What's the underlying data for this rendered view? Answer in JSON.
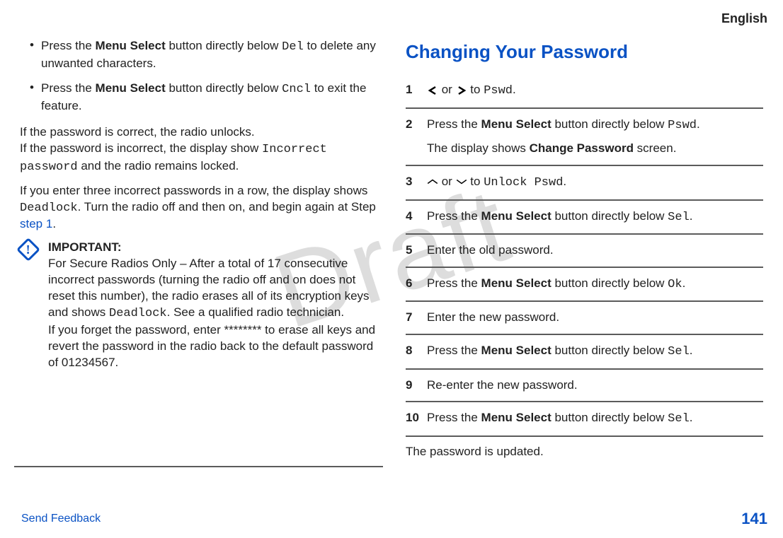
{
  "watermark": "Draft",
  "header": {
    "language": "English"
  },
  "left": {
    "bullets": [
      {
        "pre": "Press the ",
        "bold1": "Menu Select",
        "mid": " button directly below ",
        "mono": "Del",
        "post": " to delete any unwanted characters."
      },
      {
        "pre": "Press the ",
        "bold1": "Menu Select",
        "mid": " button directly below ",
        "mono": "Cncl",
        "post": " to exit the feature."
      }
    ],
    "para1_line1": "If the password is correct, the radio unlocks.",
    "para1_line2a": "If the password is incorrect, the display show ",
    "para1_mono": "Incorrect password",
    "para1_line2b": " and the radio remains locked.",
    "para2_a": "If you enter three incorrect passwords in a row, the display shows ",
    "para2_mono": "Deadlock",
    "para2_b": ". Turn the radio off and then on, and begin again at Step ",
    "para2_link": "step 1",
    "para2_c": ".",
    "important": {
      "title": "IMPORTANT:",
      "body1a": "For Secure Radios Only – After a total of 17 consecutive incorrect passwords (turning the radio off and on does not reset this number), the radio erases all of its encryption keys and shows ",
      "body1_mono": "Deadlock",
      "body1b": ". See a qualified radio technician.",
      "body2": "If you forget the password, enter ******** to erase all keys and revert the password in the radio back to the default password of 01234567."
    }
  },
  "right": {
    "heading": "Changing Your Password",
    "steps": {
      "s1_or": " or ",
      "s1_to": " to ",
      "s1_mono": "Pswd",
      "s1_dot": ".",
      "s2a": "Press the ",
      "s2_bold": "Menu Select",
      "s2b": " button directly below ",
      "s2_mono": "Pswd",
      "s2c": ".",
      "s2d": "The display shows ",
      "s2_bold2": "Change Password",
      "s2e": " screen.",
      "s3_or": " or ",
      "s3_to": " to ",
      "s3_mono": "Unlock Pswd",
      "s3_dot": ".",
      "s4a": "Press the ",
      "s4_bold": "Menu Select",
      "s4b": " button directly below ",
      "s4_mono": "Sel",
      "s4c": ".",
      "s5": "Enter the old password.",
      "s6a": "Press the ",
      "s6_bold": "Menu Select",
      "s6b": " button directly below ",
      "s6_mono": "Ok",
      "s6c": ".",
      "s7": "Enter the new password.",
      "s8a": "Press the ",
      "s8_bold": "Menu Select",
      "s8b": " button directly below ",
      "s8_mono": "Sel",
      "s8c": ".",
      "s9": "Re-enter the new password.",
      "s10a": "Press the ",
      "s10_bold": "Menu Select",
      "s10b": " button directly below ",
      "s10_mono": "Sel",
      "s10c": "."
    },
    "closing": "The password is updated."
  },
  "footer": {
    "feedback": "Send Feedback",
    "page": "141"
  },
  "step_numbers": [
    "1",
    "2",
    "3",
    "4",
    "5",
    "6",
    "7",
    "8",
    "9",
    "10"
  ]
}
